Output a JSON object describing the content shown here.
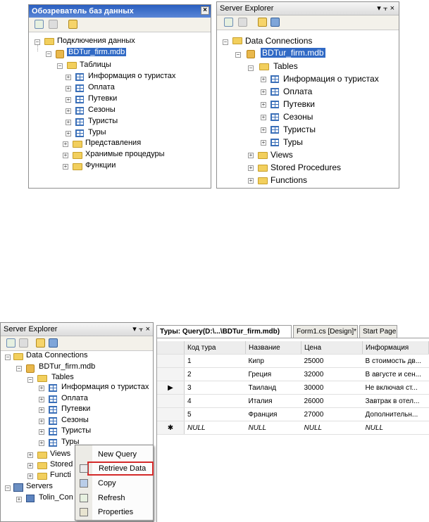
{
  "top_left": {
    "title": "Обозреватель баз данных",
    "close_glyph": "×",
    "root": "Подключения данных",
    "db": "BDTur_firm.mdb",
    "tables_folder": "Таблицы",
    "tables": [
      "Информация о туристах",
      "Оплата",
      "Путевки",
      "Сезоны",
      "Туристы",
      "Туры"
    ],
    "folders": [
      "Представления",
      "Хранимые процедуры",
      "Функции"
    ]
  },
  "top_right": {
    "title": "Server Explorer",
    "controls": "▾  ⫟  ×",
    "root": "Data Connections",
    "db": "BDTur_firm.mdb",
    "tables_folder": "Tables",
    "tables": [
      "Информация о туристах",
      "Оплата",
      "Путевки",
      "Сезоны",
      "Туристы",
      "Туры"
    ],
    "folders": [
      "Views",
      "Stored Procedures",
      "Functions"
    ]
  },
  "bottom_left": {
    "title": "Server Explorer",
    "controls": "▾  ⫟  ×",
    "root": "Data Connections",
    "db": "BDTur_firm.mdb",
    "tables_folder": "Tables",
    "tables": [
      "Информация о туристах",
      "Оплата",
      "Путевки",
      "Сезоны",
      "Туристы",
      "Туры"
    ],
    "folders": [
      "Views",
      "Stored",
      "Functi"
    ],
    "servers": "Servers",
    "server_node": "Tolin_Con"
  },
  "context_menu": {
    "items": [
      "New Query",
      "Retrieve Data",
      "Copy",
      "Refresh",
      "Properties"
    ],
    "highlight_color": "#d42a2a"
  },
  "editor": {
    "tabs": [
      "Туры: Query(D:\\...\\BDTur_firm.mdb)",
      "Form1.cs [Design]*",
      "Start Page"
    ],
    "columns": [
      "Код тура",
      "Название",
      "Цена",
      "Информация"
    ],
    "rows": [
      [
        "1",
        "Кипр",
        "25000",
        "В стоимость дв..."
      ],
      [
        "2",
        "Греция",
        "32000",
        "В августе и сен..."
      ],
      [
        "3",
        "Таиланд",
        "30000",
        "Не включая ст..."
      ],
      [
        "4",
        "Италия",
        "26000",
        "Завтрак в отел..."
      ],
      [
        "5",
        "Франция",
        "27000",
        "Дополнительн..."
      ]
    ],
    "null_row": [
      "NULL",
      "NULL",
      "NULL",
      "NULL"
    ],
    "current_marker": "▶",
    "new_marker": "✱"
  }
}
